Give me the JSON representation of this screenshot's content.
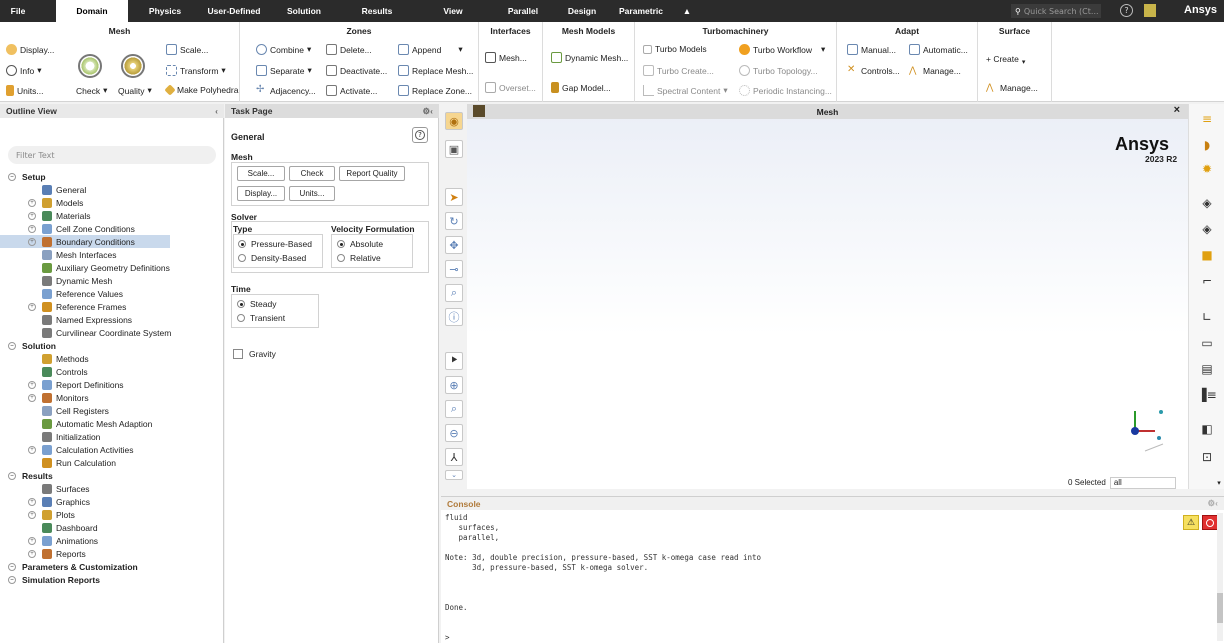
{
  "menu": {
    "tabs": [
      "File",
      "Domain",
      "Physics",
      "User-Defined",
      "Solution",
      "Results",
      "View",
      "Parallel",
      "Design",
      "Parametric"
    ],
    "collapse_glyph": "▲",
    "quick_search_placeholder": "Quick Search (Ct...",
    "brand": "Ansys",
    "active_tab": "Domain"
  },
  "ribbon": {
    "mesh": {
      "title": "Mesh",
      "display": "Display...",
      "info": "Info",
      "units": "Units...",
      "check": "Check",
      "quality": "Quality",
      "scale": "Scale...",
      "transform": "Transform",
      "make_polyhedra": "Make Polyhedra"
    },
    "zones": {
      "title": "Zones",
      "combine": "Combine",
      "separate": "Separate",
      "adjacency": "Adjacency...",
      "delete": "Delete...",
      "deactivate": "Deactivate...",
      "activate": "Activate...",
      "append": "Append",
      "replace_mesh": "Replace Mesh...",
      "replace_zone": "Replace Zone..."
    },
    "interfaces": {
      "title": "Interfaces",
      "mesh": "Mesh...",
      "overset": "Overset..."
    },
    "mesh_models": {
      "title": "Mesh Models",
      "dynamic_mesh": "Dynamic Mesh...",
      "gap_model": "Gap Model..."
    },
    "turbomachinery": {
      "title": "Turbomachinery",
      "turbo_models": "Turbo Models",
      "turbo_create": "Turbo Create...",
      "spectral_content": "Spectral Content",
      "turbo_workflow": "Turbo Workflow",
      "turbo_topology": "Turbo Topology...",
      "periodic_instancing": "Periodic Instancing..."
    },
    "adapt": {
      "title": "Adapt",
      "manual": "Manual...",
      "controls": "Controls...",
      "automatic": "Automatic...",
      "manage": "Manage..."
    },
    "surface": {
      "title": "Surface",
      "create": "+ Create",
      "manage": "Manage..."
    }
  },
  "outline": {
    "title": "Outline View",
    "filter_placeholder": "Filter Text",
    "items": [
      {
        "label": "Setup",
        "bold": true
      },
      {
        "label": "General"
      },
      {
        "label": "Models"
      },
      {
        "label": "Materials"
      },
      {
        "label": "Cell Zone Conditions"
      },
      {
        "label": "Boundary Conditions",
        "selected": true
      },
      {
        "label": "Mesh Interfaces"
      },
      {
        "label": "Auxiliary Geometry Definitions"
      },
      {
        "label": "Dynamic Mesh"
      },
      {
        "label": "Reference Values"
      },
      {
        "label": "Reference Frames"
      },
      {
        "label": "Named Expressions"
      },
      {
        "label": "Curvilinear Coordinate System"
      },
      {
        "label": "Solution",
        "bold": true
      },
      {
        "label": "Methods"
      },
      {
        "label": "Controls"
      },
      {
        "label": "Report Definitions"
      },
      {
        "label": "Monitors"
      },
      {
        "label": "Cell Registers"
      },
      {
        "label": "Automatic Mesh Adaption"
      },
      {
        "label": "Initialization"
      },
      {
        "label": "Calculation Activities"
      },
      {
        "label": "Run Calculation"
      },
      {
        "label": "Results",
        "bold": true
      },
      {
        "label": "Surfaces"
      },
      {
        "label": "Graphics"
      },
      {
        "label": "Plots"
      },
      {
        "label": "Dashboard"
      },
      {
        "label": "Animations"
      },
      {
        "label": "Reports"
      },
      {
        "label": "Parameters & Customization",
        "bold": true
      },
      {
        "label": "Simulation Reports",
        "bold": true
      }
    ]
  },
  "task_page": {
    "title": "Task Page",
    "section": "General",
    "mesh_label": "Mesh",
    "buttons": {
      "scale": "Scale...",
      "check": "Check",
      "report_quality": "Report Quality",
      "display": "Display...",
      "units": "Units..."
    },
    "solver_label": "Solver",
    "type_label": "Type",
    "type_options": [
      "Pressure-Based",
      "Density-Based"
    ],
    "type_selected": "Pressure-Based",
    "velocity_label": "Velocity Formulation",
    "velocity_options": [
      "Absolute",
      "Relative"
    ],
    "velocity_selected": "Absolute",
    "time_label": "Time",
    "time_options": [
      "Steady",
      "Transient"
    ],
    "time_selected": "Steady",
    "gravity_label": "Gravity",
    "gravity_checked": false
  },
  "graphics": {
    "title": "Mesh",
    "logo": "Ansys",
    "version": "2023 R2",
    "selected_label": "0 Selected",
    "filter_value": "all"
  },
  "console": {
    "title": "Console",
    "lines": [
      "fluid",
      "   surfaces,",
      "   parallel,",
      "",
      "Note: 3d, double precision, pressure-based, SST k-omega case read into",
      "      3d, pressure-based, SST k-omega solver.",
      "",
      "",
      "",
      "Done.",
      "",
      "",
      ">"
    ]
  },
  "colors": {
    "topbar": "#2b2b2b",
    "selection": "#c9d9ec",
    "accent": "#f0b000"
  }
}
